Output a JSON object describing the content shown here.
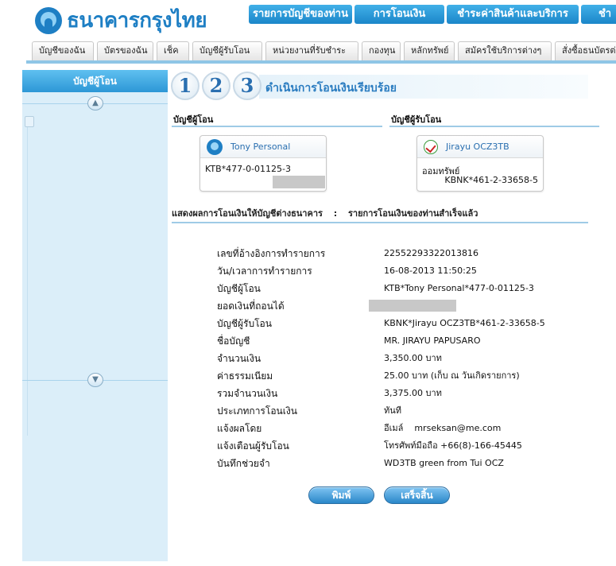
{
  "header": {
    "logo_text": "ธนาคารกรุงไทย",
    "top_nav": [
      "รายการบัญชีของท่าน",
      "การโอนเงิน",
      "ชำระค่าสินค้าและบริการ",
      "ชำ"
    ]
  },
  "tabs": [
    "บัญชีของฉัน",
    "บัตรของฉัน",
    "เช็ค",
    "บัญชีผู้รับโอน",
    "หน่วยงานที่รับชำระ",
    "กองทุน",
    "หลักทรัพย์",
    "สมัครใช้บริการต่างๆ",
    "สั่งซื้อธนบัตรต่างปร"
  ],
  "sidebar": {
    "title": "บัญชีผู้โอน"
  },
  "steps": {
    "numbers": [
      "1",
      "2",
      "3"
    ],
    "title": "ดำเนินการโอนเงินเรียบร้อย"
  },
  "from_section": {
    "label": "บัญชีผู้โอน",
    "card_name": "Tony Personal",
    "account": "KTB*477-0-01125-3"
  },
  "to_section": {
    "label": "บัญชีผู้รับโอน",
    "card_name": "Jirayu OCZ3TB",
    "account_type": "ออมทรัพย์",
    "account": "KBNK*461-2-33658-5"
  },
  "result": {
    "left": "แสดงผลการโอนเงินให้บัญชีต่างธนาคาร",
    "sep": ":",
    "right": "รายการโอนเงินของท่านสำเร็จแล้ว"
  },
  "details": [
    {
      "label": "เลขที่อ้างอิงการทำรายการ",
      "value": "22552293322013816"
    },
    {
      "label": "วัน/เวลาการทำรายการ",
      "value": "16-08-2013 11:50:25"
    },
    {
      "label": "บัญชีผู้โอน",
      "value": "KTB*Tony Personal*477-0-01125-3"
    },
    {
      "label": "ยอดเงินที่ถอนได้",
      "value": ""
    },
    {
      "label": "บัญชีผู้รับโอน",
      "value": "KBNK*Jirayu OCZ3TB*461-2-33658-5"
    },
    {
      "label": "ชื่อบัญชี",
      "value": "MR. JIRAYU PAPUSARO"
    },
    {
      "label": "จำนวนเงิน",
      "value": "3,350.00 บาท"
    },
    {
      "label": "ค่าธรรมเนียม",
      "value": "25.00 บาท (เก็บ ณ วันเกิดรายการ)"
    },
    {
      "label": "รวมจำนวนเงิน",
      "value": "3,375.00 บาท"
    },
    {
      "label": "ประเภทการโอนเงิน",
      "value": "ทันที"
    },
    {
      "label": "แจ้งผลโดย",
      "value": "อีเมล์    mrseksan@me.com"
    },
    {
      "label": "แจ้งเตือนผู้รับโอน",
      "value": "โทรศัพท์มือถือ +66(8)-166-45445"
    },
    {
      "label": "บันทึกช่วยจำ",
      "value": "WD3TB green from Tui OCZ"
    }
  ],
  "buttons": {
    "print": "พิมพ์",
    "done": "เสร็จสิ้น"
  }
}
